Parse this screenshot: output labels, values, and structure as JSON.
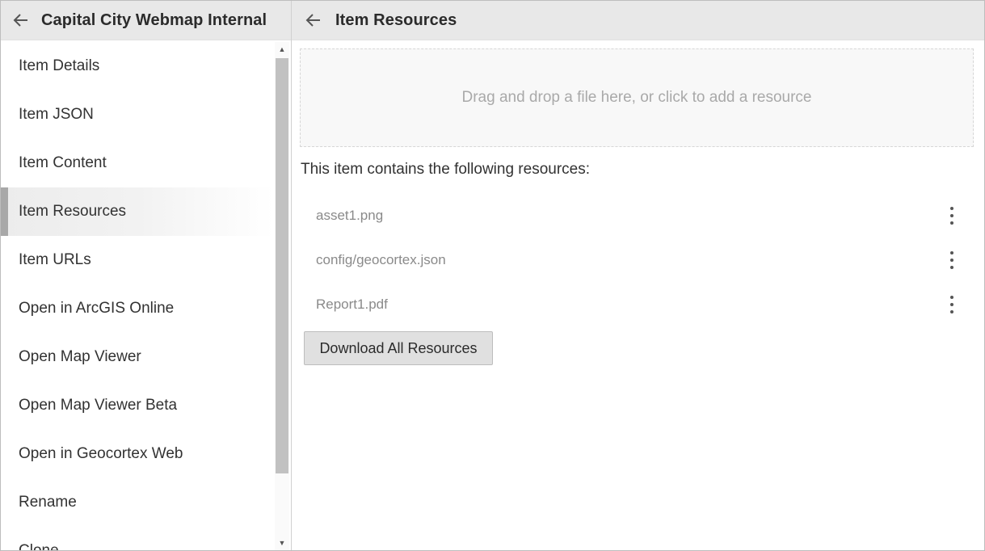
{
  "left_pane": {
    "title": "Capital City Webmap Internal",
    "nav_items": [
      {
        "label": "Item Details"
      },
      {
        "label": "Item JSON"
      },
      {
        "label": "Item Content"
      },
      {
        "label": "Item Resources",
        "active": true
      },
      {
        "label": "Item URLs"
      },
      {
        "label": "Open in ArcGIS Online"
      },
      {
        "label": "Open Map Viewer"
      },
      {
        "label": "Open Map Viewer Beta"
      },
      {
        "label": "Open in Geocortex Web"
      },
      {
        "label": "Rename"
      },
      {
        "label": "Clone"
      }
    ]
  },
  "right_pane": {
    "title": "Item Resources",
    "dropzone_text": "Drag and drop a file here, or click to add a resource",
    "intro_text": "This item contains the following resources:",
    "resources": [
      {
        "name": "asset1.png"
      },
      {
        "name": "config/geocortex.json"
      },
      {
        "name": "Report1.pdf"
      }
    ],
    "download_button_label": "Download All Resources"
  },
  "icons": {
    "back": "arrow-left-icon",
    "more": "kebab-menu-icon"
  },
  "colors": {
    "header_bg": "#e8e8e8",
    "active_indicator": "#a8a8a8",
    "button_bg": "#e0e0e0"
  }
}
